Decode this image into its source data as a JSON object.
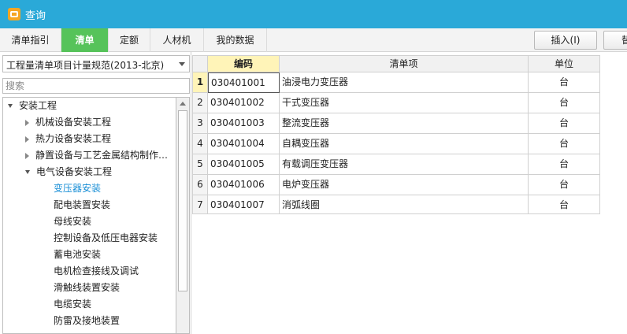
{
  "window": {
    "title": "查询",
    "icon": "query-app-icon"
  },
  "tabs": [
    {
      "label": "清单指引",
      "active": false
    },
    {
      "label": "清单",
      "active": true
    },
    {
      "label": "定额",
      "active": false
    },
    {
      "label": "人材机",
      "active": false
    },
    {
      "label": "我的数据",
      "active": false
    }
  ],
  "toolbar": {
    "insert_label": "插入(I)",
    "replace_label_partial": "替"
  },
  "sidebar": {
    "spec_select": "工程量清单项目计量规范(2013-北京)",
    "search_placeholder": "搜索",
    "tree": [
      {
        "label": "安装工程",
        "level": 0,
        "state": "expanded"
      },
      {
        "label": "机械设备安装工程",
        "level": 1,
        "state": "collapsed"
      },
      {
        "label": "热力设备安装工程",
        "level": 1,
        "state": "collapsed"
      },
      {
        "label": "静置设备与工艺金属结构制作…",
        "level": 1,
        "state": "collapsed"
      },
      {
        "label": "电气设备安装工程",
        "level": 1,
        "state": "expanded"
      },
      {
        "label": "变压器安装",
        "level": 2,
        "state": "leaf",
        "selected": true
      },
      {
        "label": "配电装置安装",
        "level": 2,
        "state": "leaf"
      },
      {
        "label": "母线安装",
        "level": 2,
        "state": "leaf"
      },
      {
        "label": "控制设备及低压电器安装",
        "level": 2,
        "state": "leaf"
      },
      {
        "label": "蓄电池安装",
        "level": 2,
        "state": "leaf"
      },
      {
        "label": "电机检查接线及调试",
        "level": 2,
        "state": "leaf"
      },
      {
        "label": "滑触线装置安装",
        "level": 2,
        "state": "leaf"
      },
      {
        "label": "电缆安装",
        "level": 2,
        "state": "leaf"
      },
      {
        "label": "防雷及接地装置",
        "level": 2,
        "state": "leaf"
      }
    ]
  },
  "table": {
    "columns": [
      "编码",
      "清单项",
      "单位"
    ],
    "rows": [
      {
        "num": "1",
        "code": "030401001",
        "name": "油浸电力变压器",
        "unit": "台"
      },
      {
        "num": "2",
        "code": "030401002",
        "name": "干式变压器",
        "unit": "台"
      },
      {
        "num": "3",
        "code": "030401003",
        "name": "整流变压器",
        "unit": "台"
      },
      {
        "num": "4",
        "code": "030401004",
        "name": "自耦变压器",
        "unit": "台"
      },
      {
        "num": "5",
        "code": "030401005",
        "name": "有载调压变压器",
        "unit": "台"
      },
      {
        "num": "6",
        "code": "030401006",
        "name": "电炉变压器",
        "unit": "台"
      },
      {
        "num": "7",
        "code": "030401007",
        "name": "消弧线圈",
        "unit": "台"
      }
    ]
  },
  "colors": {
    "titlebar": "#2aa9d8",
    "active_tab": "#56c35a",
    "selected_tree_text": "#1a8fd6",
    "active_header": "#fff4b8"
  }
}
